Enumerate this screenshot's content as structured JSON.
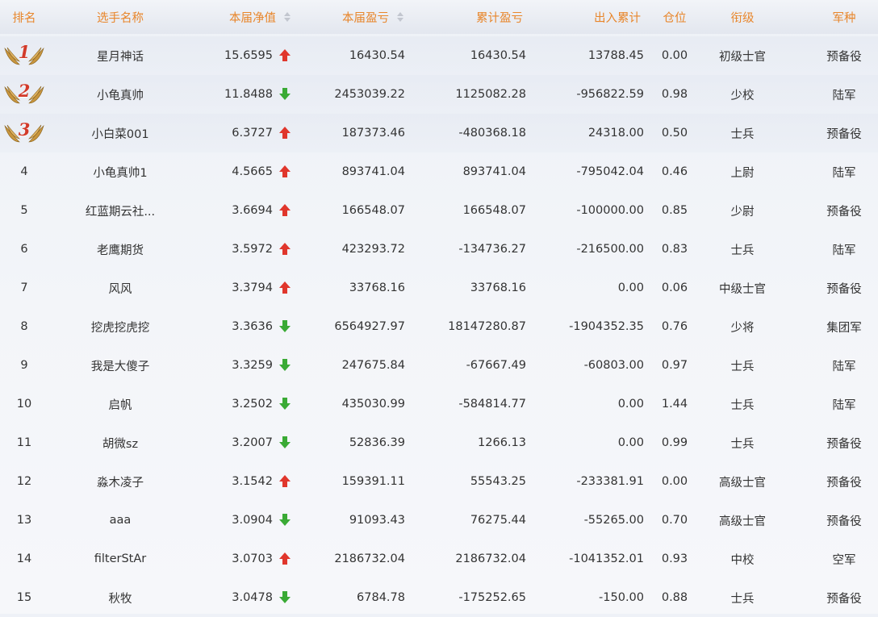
{
  "colors": {
    "header_text": "#e8862b",
    "up_arrow": "#e0362c",
    "down_arrow": "#3aaa35",
    "medal_number": "#d23a2a",
    "wing_gold": "#c9963e"
  },
  "header": {
    "rank": "排名",
    "name": "选手名称",
    "net_value": "本届净值",
    "current_pl": "本届盈亏",
    "cumulative_pl": "累计盈亏",
    "flow": "出入累计",
    "position": "仓位",
    "title_rank": "衔级",
    "arm": "军种"
  },
  "rows": [
    {
      "rank": "1",
      "medal": true,
      "name": "星月神话",
      "net": "15.6595",
      "trend": "up",
      "cur": "16430.54",
      "cum": "16430.54",
      "flow": "13788.45",
      "pos": "0.00",
      "title": "初级士官",
      "arm": "预备役"
    },
    {
      "rank": "2",
      "medal": true,
      "name": "小龟真帅",
      "net": "11.8488",
      "trend": "down",
      "cur": "2453039.22",
      "cum": "1125082.28",
      "flow": "-956822.59",
      "pos": "0.98",
      "title": "少校",
      "arm": "陆军"
    },
    {
      "rank": "3",
      "medal": true,
      "name": "小白菜001",
      "net": "6.3727",
      "trend": "up",
      "cur": "187373.46",
      "cum": "-480368.18",
      "flow": "24318.00",
      "pos": "0.50",
      "title": "士兵",
      "arm": "预备役"
    },
    {
      "rank": "4",
      "medal": false,
      "name": "小龟真帅1",
      "net": "4.5665",
      "trend": "up",
      "cur": "893741.04",
      "cum": "893741.04",
      "flow": "-795042.04",
      "pos": "0.46",
      "title": "上尉",
      "arm": "陆军"
    },
    {
      "rank": "5",
      "medal": false,
      "name": "红蓝期云社...",
      "net": "3.6694",
      "trend": "up",
      "cur": "166548.07",
      "cum": "166548.07",
      "flow": "-100000.00",
      "pos": "0.85",
      "title": "少尉",
      "arm": "预备役"
    },
    {
      "rank": "6",
      "medal": false,
      "name": "老鹰期货",
      "net": "3.5972",
      "trend": "up",
      "cur": "423293.72",
      "cum": "-134736.27",
      "flow": "-216500.00",
      "pos": "0.83",
      "title": "士兵",
      "arm": "陆军"
    },
    {
      "rank": "7",
      "medal": false,
      "name": "风风",
      "net": "3.3794",
      "trend": "up",
      "cur": "33768.16",
      "cum": "33768.16",
      "flow": "0.00",
      "pos": "0.06",
      "title": "中级士官",
      "arm": "预备役"
    },
    {
      "rank": "8",
      "medal": false,
      "name": "挖虎挖虎挖",
      "net": "3.3636",
      "trend": "down",
      "cur": "6564927.97",
      "cum": "18147280.87",
      "flow": "-1904352.35",
      "pos": "0.76",
      "title": "少将",
      "arm": "集团军"
    },
    {
      "rank": "9",
      "medal": false,
      "name": "我是大傻子",
      "net": "3.3259",
      "trend": "down",
      "cur": "247675.84",
      "cum": "-67667.49",
      "flow": "-60803.00",
      "pos": "0.97",
      "title": "士兵",
      "arm": "陆军"
    },
    {
      "rank": "10",
      "medal": false,
      "name": "启帆",
      "net": "3.2502",
      "trend": "down",
      "cur": "435030.99",
      "cum": "-584814.77",
      "flow": "0.00",
      "pos": "1.44",
      "title": "士兵",
      "arm": "陆军"
    },
    {
      "rank": "11",
      "medal": false,
      "name": "胡微sz",
      "net": "3.2007",
      "trend": "down",
      "cur": "52836.39",
      "cum": "1266.13",
      "flow": "0.00",
      "pos": "0.99",
      "title": "士兵",
      "arm": "预备役"
    },
    {
      "rank": "12",
      "medal": false,
      "name": "淼木凌子",
      "net": "3.1542",
      "trend": "up",
      "cur": "159391.11",
      "cum": "55543.25",
      "flow": "-233381.91",
      "pos": "0.00",
      "title": "高级士官",
      "arm": "预备役"
    },
    {
      "rank": "13",
      "medal": false,
      "name": "aaa",
      "net": "3.0904",
      "trend": "down",
      "cur": "91093.43",
      "cum": "76275.44",
      "flow": "-55265.00",
      "pos": "0.70",
      "title": "高级士官",
      "arm": "预备役"
    },
    {
      "rank": "14",
      "medal": false,
      "name": "filterStAr",
      "net": "3.0703",
      "trend": "up",
      "cur": "2186732.04",
      "cum": "2186732.04",
      "flow": "-1041352.01",
      "pos": "0.93",
      "title": "中校",
      "arm": "空军"
    },
    {
      "rank": "15",
      "medal": false,
      "name": "秋牧",
      "net": "3.0478",
      "trend": "down",
      "cur": "6784.78",
      "cum": "-175252.65",
      "flow": "-150.00",
      "pos": "0.88",
      "title": "士兵",
      "arm": "预备役"
    }
  ]
}
